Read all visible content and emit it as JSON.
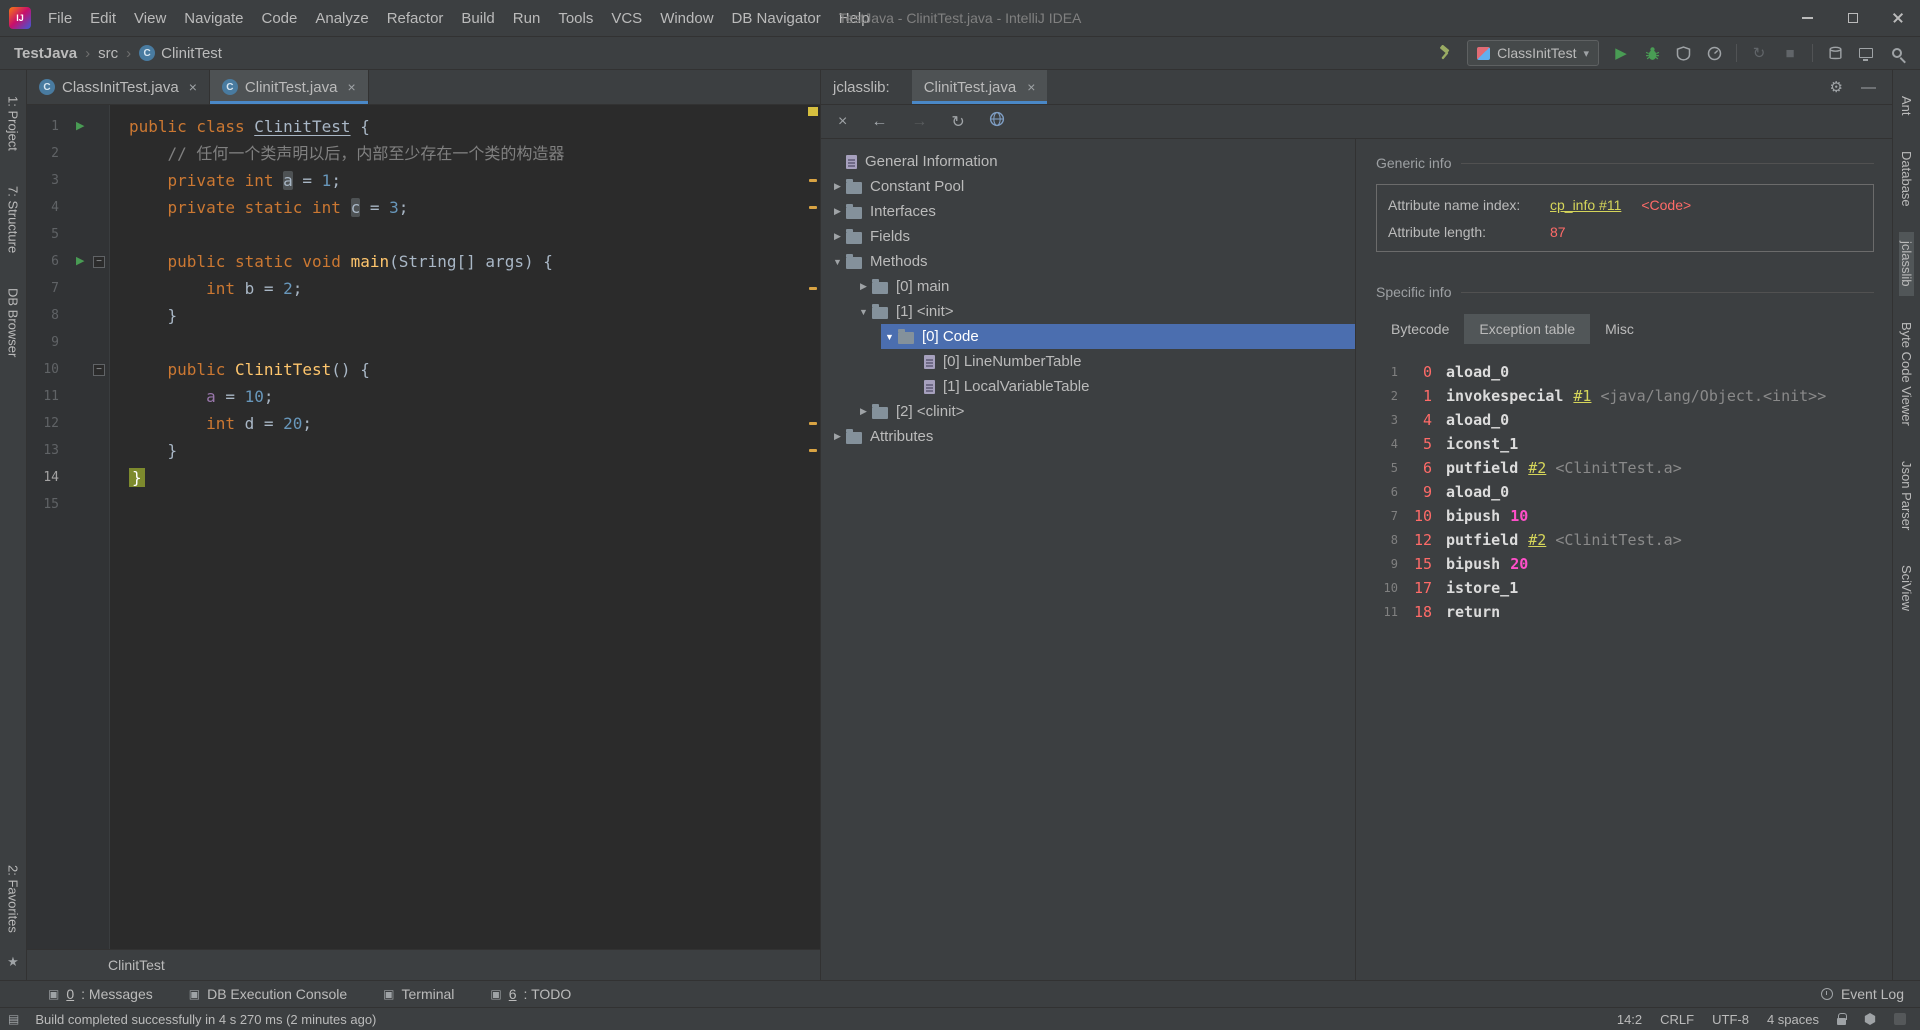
{
  "window": {
    "title": "TestJava - ClinitTest.java - IntelliJ IDEA"
  },
  "menu": {
    "items": [
      "File",
      "Edit",
      "View",
      "Navigate",
      "Code",
      "Analyze",
      "Refactor",
      "Build",
      "Run",
      "Tools",
      "VCS",
      "Window",
      "DB Navigator",
      "Help"
    ]
  },
  "breadcrumb": {
    "items": [
      "TestJava",
      "src",
      "ClinitTest"
    ]
  },
  "run": {
    "config": "ClassInitTest"
  },
  "icons": {
    "close": "×",
    "back": "←",
    "forward": "→",
    "refresh": "↻",
    "gear": "⚙",
    "minimize": "—",
    "caret_down": "▾",
    "play": "▶",
    "stop": "■",
    "rerun": "↻",
    "tool_square": "▣",
    "star": "★",
    "separator": "›",
    "tree_expanded": "▼",
    "tree_collapsed": "▶",
    "run_arrow": "▶",
    "fold_minus": "−",
    "switcher": "▤",
    "class_badge": "C"
  },
  "editor_tabs": [
    {
      "label": "ClassInitTest.java"
    },
    {
      "label": "ClinitTest.java",
      "active": true
    }
  ],
  "left_strip": {
    "top": [
      "1: Project",
      "7: Structure",
      "DB Browser"
    ],
    "bottom": [
      "2: Favorites"
    ]
  },
  "right_strip": {
    "items": [
      {
        "label": "Ant"
      },
      {
        "label": "Database"
      },
      {
        "label": "jclasslib",
        "active": true
      },
      {
        "label": "Byte Code Viewer"
      },
      {
        "label": "Json Parser"
      },
      {
        "label": "SciView"
      }
    ]
  },
  "editor": {
    "breadcrumb": "ClinitTest",
    "stripe_marks": [
      3,
      4,
      7,
      12,
      13
    ],
    "lines": [
      {
        "n": "1",
        "run": true,
        "tokens": [
          {
            "c": "kw",
            "x": "public class "
          },
          {
            "c": "cls",
            "x": "ClinitTest"
          },
          {
            "c": "pl",
            "x": " {"
          }
        ]
      },
      {
        "n": "2",
        "tokens": [
          {
            "c": "cmt",
            "x": "    // 任何一个类声明以后，内部至少存在一个类的构造器"
          }
        ]
      },
      {
        "n": "3",
        "tokens": [
          {
            "c": "kw",
            "x": "    private int "
          },
          {
            "c": "hl",
            "x": "a"
          },
          {
            "c": "pl",
            "x": " = "
          },
          {
            "c": "num",
            "x": "1"
          },
          {
            "c": "pl",
            "x": ";"
          }
        ]
      },
      {
        "n": "4",
        "tokens": [
          {
            "c": "kw",
            "x": "    private static int "
          },
          {
            "c": "hl",
            "x": "c"
          },
          {
            "c": "pl",
            "x": " = "
          },
          {
            "c": "num",
            "x": "3"
          },
          {
            "c": "pl",
            "x": ";"
          }
        ]
      },
      {
        "n": "5",
        "tokens": []
      },
      {
        "n": "6",
        "run": true,
        "fold": true,
        "tokens": [
          {
            "c": "kw",
            "x": "    public static void "
          },
          {
            "c": "met",
            "x": "main"
          },
          {
            "c": "pl",
            "x": "(String[] args) {"
          }
        ]
      },
      {
        "n": "7",
        "tokens": [
          {
            "c": "kw",
            "x": "        int "
          },
          {
            "c": "pl",
            "x": "b = "
          },
          {
            "c": "num",
            "x": "2"
          },
          {
            "c": "pl",
            "x": ";"
          }
        ]
      },
      {
        "n": "8",
        "tokens": [
          {
            "c": "pl",
            "x": "    }"
          }
        ]
      },
      {
        "n": "9",
        "tokens": []
      },
      {
        "n": "10",
        "fold": true,
        "tokens": [
          {
            "c": "kw",
            "x": "    public "
          },
          {
            "c": "met",
            "x": "ClinitTest"
          },
          {
            "c": "pl",
            "x": "() {"
          }
        ]
      },
      {
        "n": "11",
        "tokens": [
          {
            "c": "pl",
            "x": "        "
          },
          {
            "c": "field",
            "x": "a"
          },
          {
            "c": "pl",
            "x": " = "
          },
          {
            "c": "num",
            "x": "10"
          },
          {
            "c": "pl",
            "x": ";"
          }
        ]
      },
      {
        "n": "12",
        "tokens": [
          {
            "c": "kw",
            "x": "        int "
          },
          {
            "c": "pl",
            "x": "d = "
          },
          {
            "c": "num",
            "x": "20"
          },
          {
            "c": "pl",
            "x": ";"
          }
        ]
      },
      {
        "n": "13",
        "tokens": [
          {
            "c": "pl",
            "x": "    }"
          }
        ]
      },
      {
        "n": "14",
        "current": true,
        "tokens": [
          {
            "c": "brace",
            "x": "}"
          }
        ]
      },
      {
        "n": "15",
        "tokens": []
      }
    ]
  },
  "jclasslib": {
    "panel_label": "jclasslib:",
    "tab_label": "ClinitTest.java",
    "tree": [
      {
        "label": "General Information",
        "level": 0,
        "icon": "doc"
      },
      {
        "label": "Constant Pool",
        "level": 0,
        "icon": "folder",
        "arrow": "right"
      },
      {
        "label": "Interfaces",
        "level": 0,
        "icon": "folder",
        "arrow": "right"
      },
      {
        "label": "Fields",
        "level": 0,
        "icon": "folder",
        "arrow": "right"
      },
      {
        "label": "Methods",
        "level": 0,
        "icon": "folder",
        "arrow": "down"
      },
      {
        "label": "[0] main",
        "level": 1,
        "icon": "folder",
        "arrow": "right"
      },
      {
        "label": "[1] <init>",
        "level": 1,
        "icon": "folder",
        "arrow": "down"
      },
      {
        "label": "[0] Code",
        "level": 2,
        "icon": "folder",
        "arrow": "down",
        "selected": true
      },
      {
        "label": "[0] LineNumberTable",
        "level": 3,
        "icon": "doc"
      },
      {
        "label": "[1] LocalVariableTable",
        "level": 3,
        "icon": "doc"
      },
      {
        "label": "[2] <clinit>",
        "level": 1,
        "icon": "folder",
        "arrow": "right"
      },
      {
        "label": "Attributes",
        "level": 0,
        "icon": "folder",
        "arrow": "right"
      }
    ],
    "generic_info": {
      "title": "Generic info",
      "name_index_label": "Attribute name index:",
      "name_index_link": "cp_info #11",
      "name_index_type": "<Code>",
      "length_label": "Attribute length:",
      "length_value": "87"
    },
    "specific_info": {
      "title": "Specific info",
      "tabs": [
        {
          "label": "Bytecode"
        },
        {
          "label": "Exception table",
          "active": true
        },
        {
          "label": "Misc"
        }
      ]
    },
    "bytecode": [
      {
        "i": "1",
        "off": "0",
        "op": "aload_0"
      },
      {
        "i": "2",
        "off": "1",
        "op": "invokespecial",
        "link": "#1",
        "comment": "<java/lang/Object.<init>>"
      },
      {
        "i": "3",
        "off": "4",
        "op": "aload_0"
      },
      {
        "i": "4",
        "off": "5",
        "op": "iconst_1"
      },
      {
        "i": "5",
        "off": "6",
        "op": "putfield",
        "link": "#2",
        "comment": "<ClinitTest.a>"
      },
      {
        "i": "6",
        "off": "9",
        "op": "aload_0"
      },
      {
        "i": "7",
        "off": "10",
        "op": "bipush",
        "imm": "10"
      },
      {
        "i": "8",
        "off": "12",
        "op": "putfield",
        "link": "#2",
        "comment": "<ClinitTest.a>"
      },
      {
        "i": "9",
        "off": "15",
        "op": "bipush",
        "imm": "20"
      },
      {
        "i": "10",
        "off": "17",
        "op": "istore_1"
      },
      {
        "i": "11",
        "off": "18",
        "op": "return"
      }
    ]
  },
  "bottom_bar": {
    "items": [
      {
        "num": "0",
        "text": ": Messages"
      },
      {
        "text": "DB Execution Console"
      },
      {
        "text": "Terminal"
      },
      {
        "num": "6",
        "text": ": TODO"
      }
    ],
    "event_log": "Event Log"
  },
  "status_bar": {
    "message": "Build completed successfully in 4 s 270 ms (2 minutes ago)",
    "caret": "14:2",
    "line_ending": "CRLF",
    "encoding": "UTF-8",
    "indent": "4 spaces"
  }
}
